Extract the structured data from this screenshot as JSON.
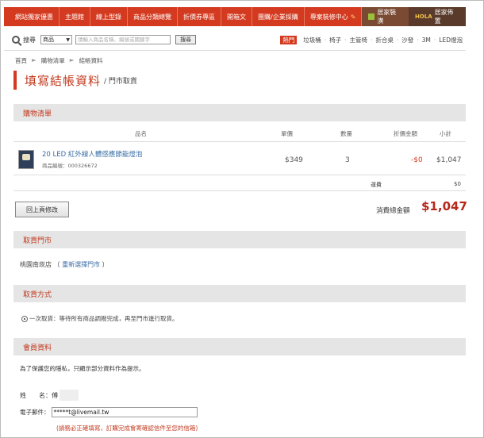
{
  "topnav": {
    "items": [
      "網站獨家優惠",
      "主題館",
      "線上型錄",
      "商品分類總覽",
      "折價券專區",
      "開箱文",
      "團購/企業採購",
      "專案裝修中心"
    ],
    "right_a": "居家裝潢",
    "right_b_logo": "HOLA",
    "right_b": "居家佈置"
  },
  "search": {
    "label": "搜尋",
    "category": "商品",
    "placeholder": "請輸入商品名稱、編號或關鍵字",
    "button": "搜尋",
    "hot_label": "熱門",
    "hot_links": [
      "垃圾桶",
      "椅子",
      "主管椅",
      "折合桌",
      "沙發",
      "3M",
      "LED燈泡"
    ]
  },
  "breadcrumb": [
    "首頁",
    "購物清單",
    "結帳資料"
  ],
  "page": {
    "title": "填寫結帳資料",
    "subtitle": "/ 門市取貨"
  },
  "cart": {
    "heading": "購物清單",
    "columns": [
      "品名",
      "單價",
      "數量",
      "折價金額",
      "小計"
    ],
    "items": [
      {
        "name": "20 LED 紅外線人體感應節能燈泡",
        "code": "商品編號：000326672",
        "price": "$349",
        "qty": "3",
        "discount": "-$0",
        "subtotal": "$1,047"
      }
    ],
    "shipping_label": "運費",
    "shipping_value": "$0",
    "back_button": "回上頁修改",
    "total_label": "消費總金額",
    "total_value": "$1,047"
  },
  "pickup_store": {
    "heading": "取貨門市",
    "store": "桃園南崁店",
    "reselect_open": "（",
    "reselect": "重新選擇門市",
    "reselect_close": "）"
  },
  "pickup_method": {
    "heading": "取貨方式",
    "option": "一次取貨：等待所有商品調撥完成，再至門市進行取貨。"
  },
  "member": {
    "heading": "會員資料",
    "privacy": "為了保護您的隱私，只顯示部分資料作為提示。",
    "name_label": "姓　　名：",
    "name_value": "傅",
    "email_label": "電子郵件：",
    "email_value": "*****t@livemail.tw",
    "note": "(請務必正確填寫，訂購完成會寄確認信件至您的信箱)"
  },
  "colors": {
    "accent": "#d33a1f",
    "section_bg": "#e5e5e5",
    "link": "#3a6ea5"
  }
}
